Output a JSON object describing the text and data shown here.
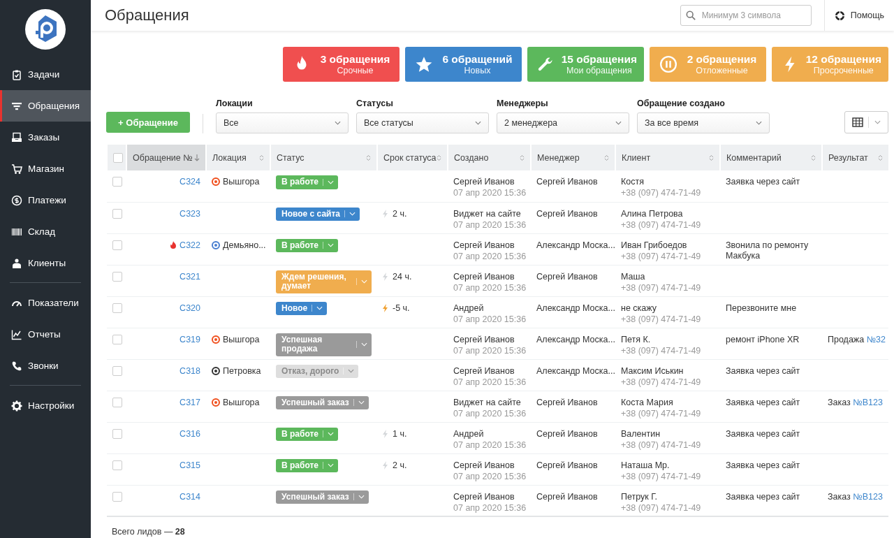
{
  "sidebar": {
    "sections": [
      {
        "items": [
          {
            "label": "Задачи",
            "selected": false
          },
          {
            "label": "Обращения",
            "selected": true
          },
          {
            "label": "Заказы",
            "selected": false
          },
          {
            "label": "Магазин",
            "selected": false
          },
          {
            "label": "Платежи",
            "selected": false
          },
          {
            "label": "Склад",
            "selected": false
          },
          {
            "label": "Клиенты",
            "selected": false
          }
        ]
      },
      {
        "items": [
          {
            "label": "Показатели",
            "selected": false
          },
          {
            "label": "Отчеты",
            "selected": false
          },
          {
            "label": "Звонки",
            "selected": false
          }
        ]
      },
      {
        "items": [
          {
            "label": "Настройки",
            "selected": false
          }
        ]
      }
    ]
  },
  "header": {
    "title": "Обращения",
    "search": {
      "placeholder": "Минимум 3 символа"
    },
    "help": "Помощь"
  },
  "stat_cards": [
    {
      "title": "3 обращения",
      "subtitle": "Срочные",
      "color": "#f04f4f"
    },
    {
      "title": "6 обращений",
      "subtitle": "Новых",
      "color": "#3d86cc"
    },
    {
      "title": "15 обращения",
      "subtitle": "Мои обращения",
      "color": "#5cb85c"
    },
    {
      "title": "2 обращения",
      "subtitle": "Отложенные",
      "color": "#f0ad4e"
    },
    {
      "title": "12 обращения",
      "subtitle": "Просроченные",
      "color": "#f0ad4e"
    }
  ],
  "add_button": "+ Обращение",
  "filters": [
    {
      "label": "Локации",
      "value": "Все"
    },
    {
      "label": "Статусы",
      "value": "Все статусы"
    },
    {
      "label": "Менеджеры",
      "value": "2 менеджера"
    },
    {
      "label": "Обращение создано",
      "value": "За все время"
    }
  ],
  "table": {
    "select_all": {
      "checked": false
    },
    "columns": [
      {
        "label": "Обращение №",
        "sorted": true
      },
      {
        "label": "Локация",
        "sorted": false
      },
      {
        "label": "Статус",
        "sorted": false
      },
      {
        "label": "Срок статуса",
        "sorted": false
      },
      {
        "label": "Создано",
        "sorted": false
      },
      {
        "label": "Менеджер",
        "sorted": false
      },
      {
        "label": "Клиент",
        "sorted": false
      },
      {
        "label": "Комментарий",
        "sorted": false
      },
      {
        "label": "Результат",
        "sorted": false
      }
    ],
    "rows": [
      {
        "checked": false,
        "number": "C324",
        "urgent": false,
        "location": {
          "name": "Вышгора",
          "color": "#f0501e"
        },
        "status": {
          "label": "В работе",
          "color": "#5cb85c"
        },
        "created_by": "Сергей Иванов",
        "created_at": "07 апр 2020 15:36",
        "manager": "Сергей Иванов",
        "client": "Костя",
        "phone": "+38 (097) 474-71-49",
        "comment": "Заявка через сайт"
      },
      {
        "checked": false,
        "number": "C323",
        "urgent": false,
        "status": {
          "label": "Новое с сайта",
          "color": "#3d86cc"
        },
        "status_time": {
          "text": "2 ч.",
          "overdue": false
        },
        "created_by": "Виджет на сайте",
        "created_at": "07 апр 2020 15:36",
        "manager": "Сергей Иванов",
        "client": "Алина Петрова",
        "phone": "+38 (097) 474-71-49"
      },
      {
        "checked": false,
        "number": "C322",
        "urgent": true,
        "location": {
          "name": "Демьяно...",
          "color": "#4a7fd0"
        },
        "status": {
          "label": "В работе",
          "color": "#5cb85c"
        },
        "created_by": "Сергей Иванов",
        "created_at": "07 апр 2020 15:36",
        "manager": "Александр Моска...",
        "client": "Иван Грибоедов",
        "phone": "+38 (097) 474-71-49",
        "comment": "Звонила по ремонту Макбука"
      },
      {
        "checked": false,
        "number": "C321",
        "urgent": false,
        "status": {
          "label": "Ждем решения, думает",
          "color": "#f0ad4e"
        },
        "status_time": {
          "text": "24 ч.",
          "overdue": false
        },
        "created_by": "Сергей Иванов",
        "created_at": "07 апр 2020 15:36",
        "manager": "Сергей Иванов",
        "client": "Маша",
        "phone": "+38 (097) 474-71-49"
      },
      {
        "checked": false,
        "number": "C320",
        "urgent": false,
        "status": {
          "label": "Новое",
          "color": "#3d86cc"
        },
        "status_time": {
          "text": "-5 ч.",
          "overdue": true
        },
        "created_by": "Андрей",
        "created_at": "07 апр 2020 15:36",
        "manager": "Александр Моска...",
        "client": "не скажу",
        "phone": "+38 (097) 474-71-49",
        "comment": "Перезвоните мне"
      },
      {
        "checked": false,
        "number": "C319",
        "urgent": false,
        "location": {
          "name": "Вышгора",
          "color": "#f0501e"
        },
        "status": {
          "label": "Успешная продажа",
          "color": "#9a9a9a"
        },
        "created_by": "Сергей Иванов",
        "created_at": "07 апр 2020 15:36",
        "manager": "Александр Моска...",
        "client": "Петя К.",
        "phone": "+38 (097) 474-71-49",
        "comment": "ремонт iPhone XR",
        "result": {
          "text": "Продажа",
          "link": "№32"
        }
      },
      {
        "checked": false,
        "number": "C318",
        "urgent": false,
        "location": {
          "name": "Петровка",
          "color": "#333333"
        },
        "status": {
          "label": "Отказ, дорого",
          "color": "#dedede"
        },
        "created_by": "Сергей Иванов",
        "created_at": "07 апр 2020 15:36",
        "manager": "Александр Моска...",
        "client": "Максим Иськин",
        "phone": "+38 (097) 474-71-49",
        "comment": "Заявка через сайт"
      },
      {
        "checked": false,
        "number": "C317",
        "urgent": false,
        "location": {
          "name": "Вышгора",
          "color": "#f0501e"
        },
        "status": {
          "label": "Успешный заказ",
          "color": "#9a9a9a"
        },
        "created_by": "Виджет на сайте",
        "created_at": "07 апр 2020 15:36",
        "manager": "Сергей Иванов",
        "client": "Коста Мария",
        "phone": "+38 (097) 474-71-49",
        "comment": "Заявка через сайт",
        "result": {
          "text": "Заказ",
          "link": "№B123"
        }
      },
      {
        "checked": false,
        "number": "C316",
        "urgent": false,
        "status": {
          "label": "В работе",
          "color": "#5cb85c"
        },
        "status_time": {
          "text": "1 ч.",
          "overdue": false
        },
        "created_by": "Андрей",
        "created_at": "07 апр 2020 15:36",
        "manager": "Сергей Иванов",
        "client": "Валентин",
        "phone": "+38 (097) 474-71-49",
        "comment": "Заявка через сайт"
      },
      {
        "checked": false,
        "number": "C315",
        "urgent": false,
        "status": {
          "label": "В работе",
          "color": "#5cb85c"
        },
        "status_time": {
          "text": "2 ч.",
          "overdue": false
        },
        "created_by": "Сергей Иванов",
        "created_at": "07 апр 2020 15:36",
        "manager": "Сергей Иванов",
        "client": "Наташа Мр.",
        "phone": "+38 (097) 474-71-49",
        "comment": "Заявка через сайт"
      },
      {
        "checked": false,
        "number": "C314",
        "urgent": false,
        "status": {
          "label": "Успешный заказ",
          "color": "#9a9a9a"
        },
        "created_by": "Сергей Иванов",
        "created_at": "07 апр 2020 15:36",
        "manager": "Сергей Иванов",
        "client": "Петрук Г.",
        "phone": "+38 (097) 474-71-49",
        "comment": "Заявка через сайт",
        "result": {
          "text": "Заказ",
          "link": "№B123"
        }
      }
    ]
  },
  "footer": "Всего лидов — **28**"
}
